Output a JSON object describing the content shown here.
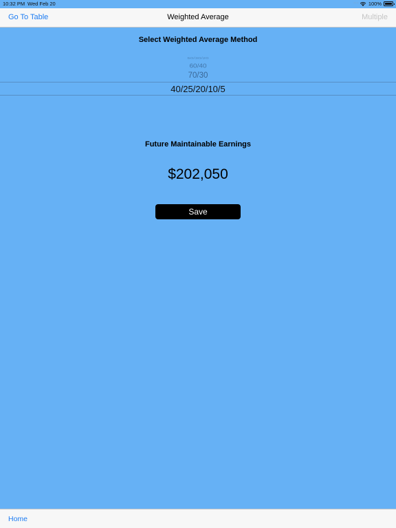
{
  "status_bar": {
    "time": "10:32 PM",
    "date": "Wed Feb 20",
    "battery": "100%",
    "wifi_icon": "wifi-icon",
    "battery_icon": "battery-full-icon"
  },
  "nav": {
    "left_button": "Go To Table",
    "title": "Weighted Average",
    "right_button": "Multiple"
  },
  "picker": {
    "heading": "Select Weighted Average Method",
    "items": [
      "50/30/20",
      "60/40",
      "70/30",
      "40/25/20/10/5"
    ],
    "selected": "40/25/20/10/5"
  },
  "result": {
    "label": "Future Maintainable Earnings",
    "value": "$202,050"
  },
  "save_button": "Save",
  "toolbar": {
    "home": "Home"
  },
  "colors": {
    "background": "#66B1F5",
    "link": "#1E7CF2",
    "bar": "#F7F7F7",
    "button": "#000000"
  }
}
